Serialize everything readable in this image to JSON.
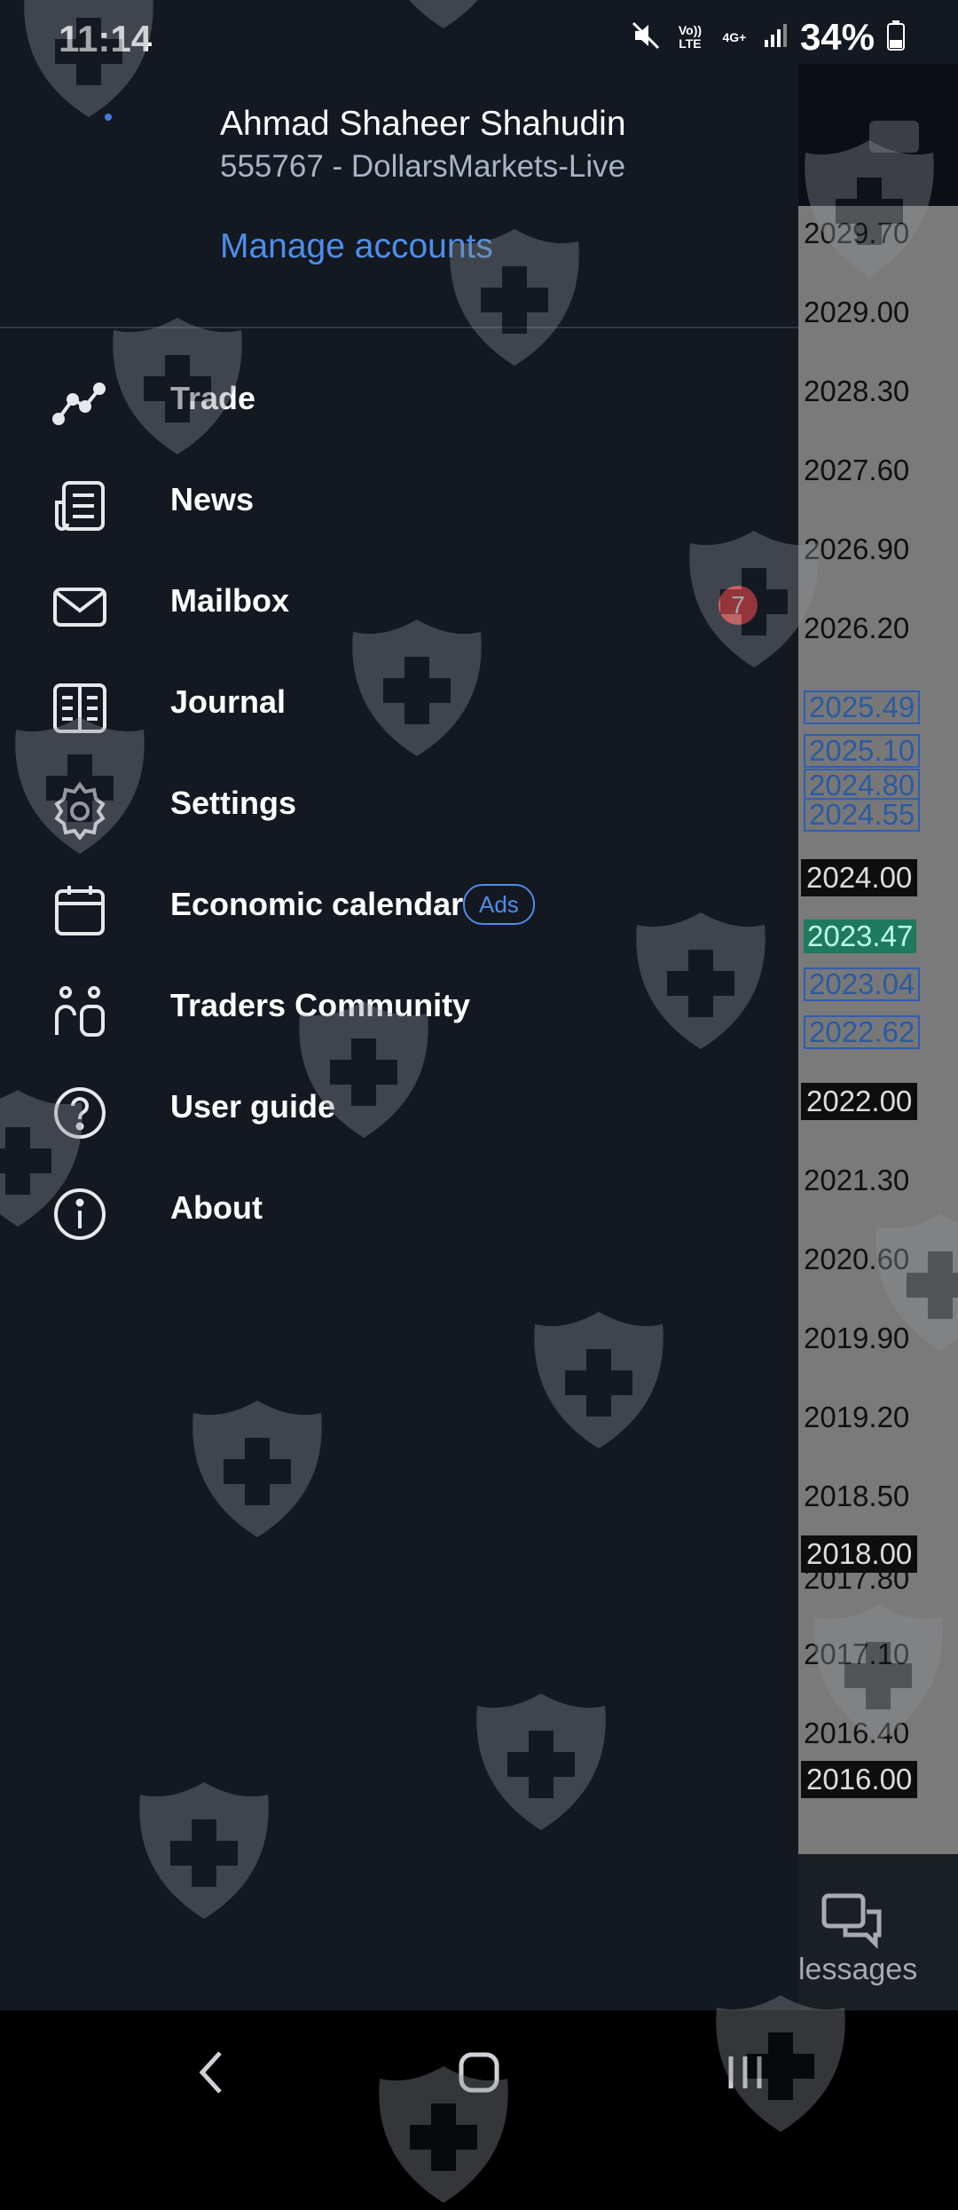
{
  "status_bar": {
    "time": "11:14",
    "network_top": "Vo)) LTE",
    "network_gen": "4G+",
    "battery": "34%"
  },
  "account": {
    "name": "Ahmad Shaheer Shahudin",
    "id_line": "555767 - DollarsMarkets-Live",
    "manage_label": "Manage accounts"
  },
  "menu": {
    "items": [
      {
        "label": "Trade",
        "icon": "chart-line-icon"
      },
      {
        "label": "News",
        "icon": "news-icon"
      },
      {
        "label": "Mailbox",
        "icon": "mail-icon",
        "badge": "7"
      },
      {
        "label": "Journal",
        "icon": "journal-icon"
      },
      {
        "label": "Settings",
        "icon": "gear-icon"
      },
      {
        "label": "Economic calendar",
        "icon": "calendar-icon",
        "tag": "Ads"
      },
      {
        "label": "Traders Community",
        "icon": "community-icon"
      },
      {
        "label": "User guide",
        "icon": "help-icon"
      },
      {
        "label": "About",
        "icon": "info-icon"
      }
    ]
  },
  "chart_prices": {
    "axis": [
      "2029.70",
      "2029.00",
      "2028.30",
      "2027.60",
      "2026.90",
      "2026.20",
      "2021.30",
      "2020.60",
      "2019.90",
      "2019.20",
      "2018.50",
      "2017.80",
      "2017.10",
      "2016.40"
    ],
    "boxed": [
      "2025.49",
      "2025.10",
      "2024.80",
      "2024.55",
      "2023.04",
      "2022.62"
    ],
    "dark": [
      "2024.00",
      "2022.00",
      "2018.00",
      "2016.00"
    ],
    "highlight": "2023.47"
  },
  "background_tab": {
    "label": "lessages"
  },
  "colors": {
    "drawer_bg": "#131821",
    "accent": "#4d8eea",
    "badge_red": "#e5484d"
  }
}
